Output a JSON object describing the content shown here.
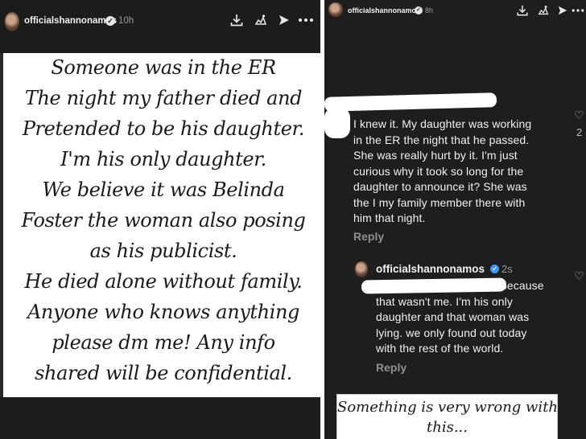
{
  "left_story": {
    "username": "officialshannonamos",
    "time": "10h",
    "lines": [
      "Someone was in the ER",
      "The night my father died and",
      "Pretended to be his daughter.",
      "I'm his only daughter.",
      "We believe it was Belinda",
      "Foster the woman also posing",
      "as his publicist.",
      "He died alone without family.",
      "Anyone who knows anything",
      "please dm me! Any info",
      "shared will be confidential."
    ]
  },
  "right_story": {
    "username": "officialshannonamos",
    "time": "8h",
    "comment": {
      "lines": [
        "I knew it. My daughter was working",
        "in the ER the night that he passed.",
        "She was really hurt by it. I'm just",
        "curious why it took so long for the",
        "daughter to announce it? She was",
        "the I my family member there with",
        "him that night."
      ],
      "reply_label": "Reply",
      "like_count": "2"
    },
    "reply_comment": {
      "username": "officialshannonamos",
      "time": "2s",
      "lines": [
        "because",
        "that wasn't me. I'm his only",
        "daughter and that woman was",
        "lying. we only found out today",
        "with the rest of the world."
      ],
      "reply_label": "Reply"
    },
    "caption": {
      "lines": [
        "Something is very wrong with",
        "this..."
      ]
    }
  },
  "icons": {
    "verified": "verified-badge-icon",
    "download": "download-icon",
    "sticker": "sticker-icon",
    "send": "send-icon",
    "more": "more-icon",
    "heart": "heart-outline-icon"
  },
  "colors": {
    "background": "#1c1c1c",
    "text": "#f1f1f1",
    "muted": "#8e8e8e",
    "verified": "#3897f0",
    "story_card": "#ffffff"
  }
}
